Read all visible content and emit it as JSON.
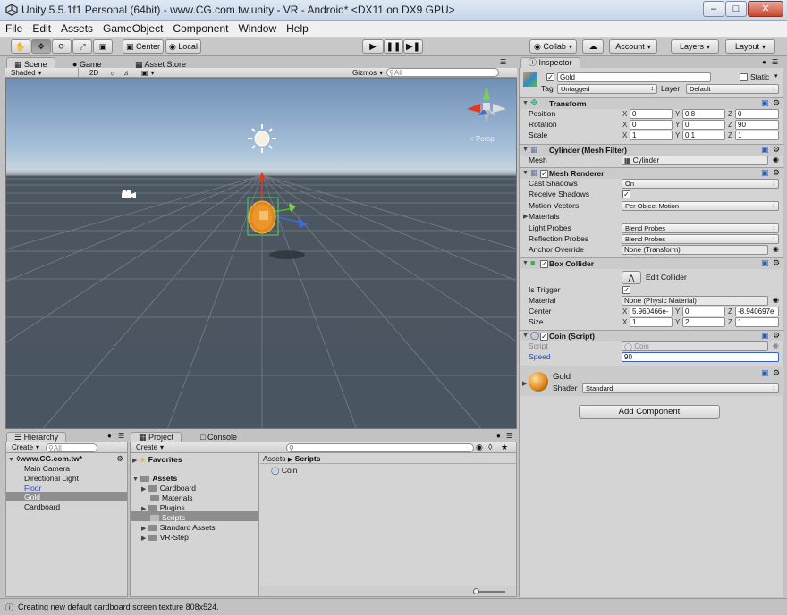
{
  "window": {
    "title": "Unity 5.5.1f1 Personal (64bit) - www.CG.com.tw.unity - VR - Android* <DX11 on DX9 GPU>"
  },
  "menu": [
    "File",
    "Edit",
    "Assets",
    "GameObject",
    "Component",
    "Window",
    "Help"
  ],
  "toolbar": {
    "pivot": "Center",
    "space": "Local",
    "collab": "Collab",
    "account": "Account",
    "layers": "Layers",
    "layout": "Layout"
  },
  "scene": {
    "tabs": [
      "Scene",
      "Game",
      "Asset Store"
    ],
    "shading": "Shaded",
    "mode_2d": "2D",
    "gizmos": "Gizmos",
    "search_placeholder": "All",
    "persp_label": "< Persp"
  },
  "hierarchy": {
    "tab": "Hierarchy",
    "create": "Create",
    "search_placeholder": "All",
    "scene_name": "www.CG.com.tw*",
    "items": [
      "Main Camera",
      "Directional Light",
      "Floor",
      "Gold",
      "Cardboard"
    ]
  },
  "project": {
    "tabs": [
      "Project",
      "Console"
    ],
    "create": "Create",
    "favorites": "Favorites",
    "assets": "Assets",
    "folders": [
      "Cardboard",
      "Materials",
      "Plugins",
      "Scripts",
      "Standard Assets",
      "VR-Step"
    ],
    "breadcrumb": [
      "Assets",
      "Scripts"
    ],
    "files": [
      "Coin"
    ]
  },
  "inspector": {
    "tab": "Inspector",
    "name": "Gold",
    "static": "Static",
    "tag_label": "Tag",
    "tag": "Untagged",
    "layer_label": "Layer",
    "layer": "Default",
    "transform": {
      "title": "Transform",
      "position_label": "Position",
      "position": [
        "0",
        "0.8",
        "0"
      ],
      "rotation_label": "Rotation",
      "rotation": [
        "0",
        "0",
        "90"
      ],
      "scale_label": "Scale",
      "scale": [
        "1",
        "0.1",
        "1"
      ]
    },
    "mesh_filter": {
      "title": "Cylinder (Mesh Filter)",
      "mesh_label": "Mesh",
      "mesh": "Cylinder"
    },
    "mesh_renderer": {
      "title": "Mesh Renderer",
      "rows": [
        {
          "label": "Cast Shadows",
          "value": "On"
        },
        {
          "label": "Receive Shadows",
          "value": ""
        },
        {
          "label": "Motion Vectors",
          "value": "Per Object Motion"
        },
        {
          "label": "Materials",
          "value": ""
        },
        {
          "label": "Light Probes",
          "value": "Blend Probes"
        },
        {
          "label": "Reflection Probes",
          "value": "Blend Probes"
        },
        {
          "label": "Anchor Override",
          "value": "None (Transform)"
        }
      ]
    },
    "box_collider": {
      "title": "Box Collider",
      "edit": "Edit Collider",
      "is_trigger_label": "Is Trigger",
      "material_label": "Material",
      "material": "None (Physic Material)",
      "center_label": "Center",
      "center": [
        "5.960466e-",
        "0",
        "-8.940697e"
      ],
      "size_label": "Size",
      "size": [
        "1",
        "2",
        "1"
      ]
    },
    "coin_script": {
      "title": "Coin (Script)",
      "script_label": "Script",
      "script": "Coin",
      "speed_label": "Speed",
      "speed": "90"
    },
    "material": {
      "name": "Gold",
      "shader_label": "Shader",
      "shader": "Standard"
    },
    "add_component": "Add Component"
  },
  "status": "Creating new default cardboard screen texture 808x524.",
  "colors": {
    "selection": "#8e8e8e",
    "highlight_blue": "#3a5fcd",
    "gold": "#e08a1e"
  }
}
